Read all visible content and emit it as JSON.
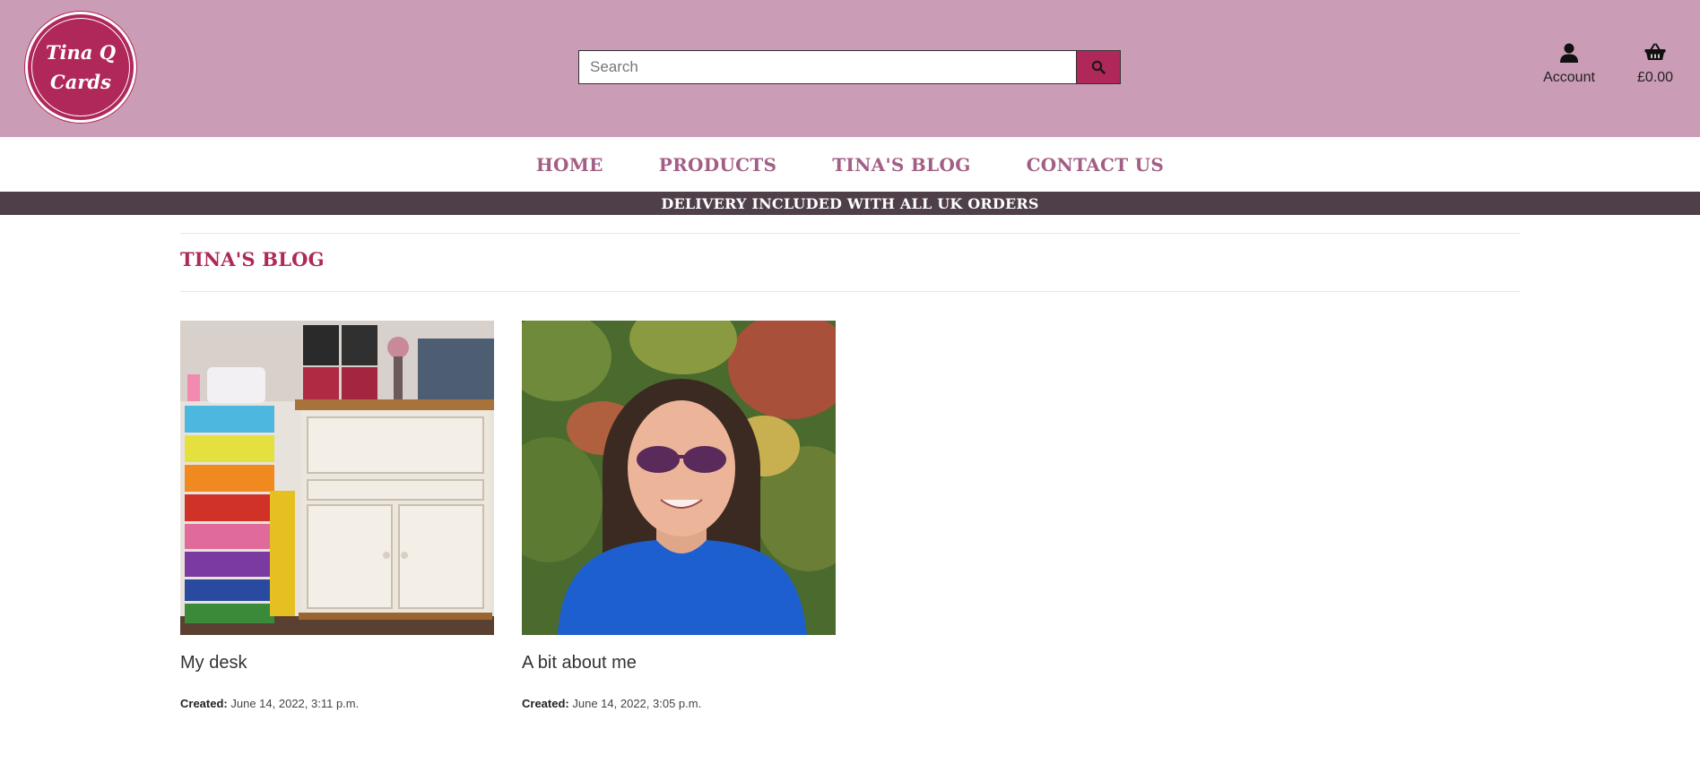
{
  "logo": {
    "line1": "Tina Q",
    "line2": "Cards"
  },
  "search": {
    "placeholder": "Search"
  },
  "header": {
    "account_label": "Account",
    "cart_total": "£0.00"
  },
  "nav": {
    "items": [
      "Home",
      "Products",
      "Tina's Blog",
      "Contact Us"
    ]
  },
  "banner": {
    "text": "DELIVERY INCLUDED WITH ALL UK ORDERS"
  },
  "page": {
    "title": "TINA'S BLOG"
  },
  "posts": [
    {
      "title": "My desk",
      "created_label": "Created:",
      "created": "June 14, 2022, 3:11 p.m."
    },
    {
      "title": "A bit about me",
      "created_label": "Created:",
      "created": "June 14, 2022, 3:05 p.m."
    }
  ],
  "colors": {
    "header_bg": "#cb9cb5",
    "accent": "#b0285a",
    "nav_text": "#a35e85",
    "banner_bg": "#4e3f49"
  }
}
